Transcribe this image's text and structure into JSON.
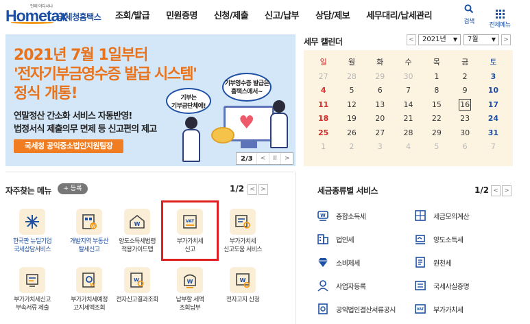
{
  "logo": {
    "tagline": "언제 어디서나",
    "wordmark": "Hometax",
    "korean_name": "국세청홈택스"
  },
  "gnb": [
    "조회/발급",
    "민원증명",
    "신청/제출",
    "신고/납부",
    "상담/제보",
    "세무대리/납세관리"
  ],
  "header_buttons": {
    "search": "검색",
    "all_menu": "전체메뉴"
  },
  "banner": {
    "line1": "2021년 7월 1일부터",
    "line2": "'전자기부금영수증 발급 시스템'",
    "line3": "정식 개통!",
    "line4": "연말정산 간소화 서비스 자동반영!",
    "line5": "법정서식 제출의무 면제 등 신고편의 제고",
    "pill": "국세청 공익중소법인지원팀장",
    "bubble1_line1": "기부는",
    "bubble1_line2": "기부금단체에!",
    "bubble2_line1": "기부영수증 발급은",
    "bubble2_line2": "홈택스에서~",
    "counter": "2/3",
    "colors": {
      "background": "#d4e7f8",
      "headline": "#e8731c",
      "pill": "#f07d21"
    }
  },
  "calendar": {
    "title": "세무 캘린더",
    "year": "2021년",
    "month": "7월",
    "weekdays": [
      "일",
      "월",
      "화",
      "수",
      "목",
      "금",
      "토"
    ],
    "weeks": [
      [
        "27",
        "28",
        "29",
        "30",
        "1",
        "2",
        "3"
      ],
      [
        "4",
        "5",
        "6",
        "7",
        "8",
        "9",
        "10"
      ],
      [
        "11",
        "12",
        "13",
        "14",
        "15",
        "16",
        "17"
      ],
      [
        "18",
        "19",
        "20",
        "21",
        "22",
        "23",
        "24"
      ],
      [
        "25",
        "26",
        "27",
        "28",
        "29",
        "30",
        "31"
      ],
      [
        "1",
        "2",
        "3",
        "4",
        "5",
        "6",
        "7"
      ]
    ],
    "today": "16",
    "colors": {
      "background": "#fdf3e1",
      "sunday": "#d42a2a",
      "saturday": "#1d4fa3",
      "outside_month": "#b7b7b7"
    }
  },
  "favorites": {
    "title": "자주찾는 메뉴",
    "add_label": "+ 등록",
    "pager": "1/2",
    "items": [
      {
        "line1": "한국판 뉴딜기업",
        "line2": "국세상담서비스",
        "icon": "newdeal-icon"
      },
      {
        "line1": "개발지역 부동산",
        "line2": "탈세신고",
        "icon": "real-estate-report-icon"
      },
      {
        "line1": "양도소득세법령",
        "line2": "적용가이드맵",
        "icon": "house-won-icon"
      },
      {
        "line1": "부가가치세",
        "line2": "신고",
        "icon": "vat-report-icon"
      },
      {
        "line1": "부가가치세",
        "line2": "신고도움 서비스",
        "icon": "vat-help-icon"
      },
      {
        "line1": "부가가치세신고",
        "line2": "부속서류 제출",
        "icon": "attachment-submit-icon"
      },
      {
        "line1": "부가가치세예정",
        "line2": "고지세액조회",
        "icon": "notice-tax-search-icon"
      },
      {
        "line1": "전자신고결과조회",
        "line2": "",
        "icon": "result-search-icon"
      },
      {
        "line1": "납부할 세액",
        "line2": "조회납부",
        "icon": "tax-payment-icon"
      },
      {
        "line1": "전자고지 신청",
        "line2": "",
        "icon": "e-notice-icon"
      }
    ],
    "colors": {
      "icon_bg": "#fbeed6",
      "highlight": "#e02020"
    }
  },
  "tax_services": {
    "title": "세금종류별 서비스",
    "pager": "1/2",
    "items": [
      "종합소득세",
      "세금모의계산",
      "법인세",
      "양도소득세",
      "소비제세",
      "원천세",
      "사업자등록",
      "국세사실증명",
      "공익법인결산서류공시",
      "부가가치세"
    ],
    "icons": [
      "income-tax-icon",
      "calculator-icon",
      "corporate-building-icon",
      "house-transfer-icon",
      "gem-icon",
      "withholding-doc-icon",
      "person-icon",
      "certificate-icon",
      "public-notice-icon",
      "vat-doc-icon"
    ],
    "icon_color": "#1d4fa3"
  }
}
